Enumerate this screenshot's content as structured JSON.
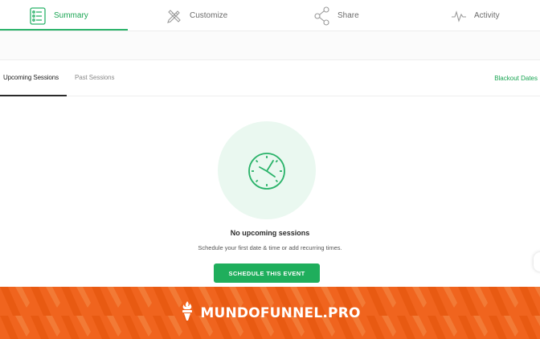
{
  "tabs": [
    {
      "label": "Summary",
      "icon": "list-icon",
      "active": true
    },
    {
      "label": "Customize",
      "icon": "pencil-ruler-icon",
      "active": false
    },
    {
      "label": "Share",
      "icon": "share-icon",
      "active": false
    },
    {
      "label": "Activity",
      "icon": "pulse-icon",
      "active": false
    }
  ],
  "subtabs": [
    {
      "label": "Upcoming Sessions",
      "active": true
    },
    {
      "label": "Past Sessions",
      "active": false
    }
  ],
  "blackout_label": "Blackout Dates",
  "empty_state": {
    "icon": "clock-icon",
    "title": "No upcoming sessions",
    "subtitle": "Schedule your first date & time or add recurring times.",
    "button_label": "SCHEDULE THIS EVENT"
  },
  "banner": {
    "brand": "MUNDOFUNNEL.PRO",
    "logo_icon": "torch-icon"
  },
  "colors": {
    "accent_green": "#1aa553",
    "button_green": "#1fae5c",
    "circle_bg": "#eaf8f0",
    "banner_orange": "#f0641e"
  }
}
